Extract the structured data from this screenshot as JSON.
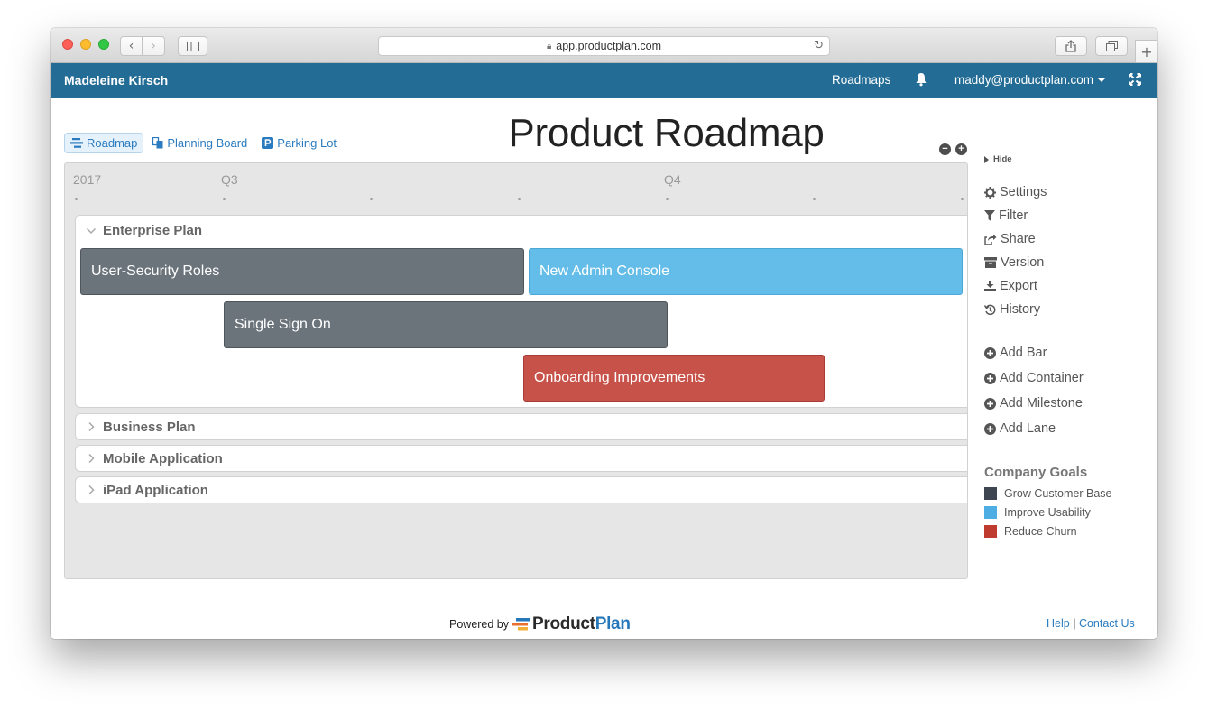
{
  "browser": {
    "url": "app.productplan.com"
  },
  "header": {
    "user_name": "Madeleine Kirsch",
    "nav_roadmaps": "Roadmaps",
    "account_email": "maddy@productplan.com"
  },
  "view_tabs": [
    {
      "label": "Roadmap",
      "active": true
    },
    {
      "label": "Planning Board",
      "active": false
    },
    {
      "label": "Parking Lot",
      "active": false
    }
  ],
  "page_title": "Product Roadmap",
  "zoom": {
    "out": "−",
    "in": "+"
  },
  "timeline": {
    "labels": [
      "2017",
      "Q3",
      "Q4"
    ]
  },
  "lanes": [
    {
      "title": "Enterprise Plan",
      "expanded": true,
      "bars": [
        {
          "label": "User-Security Roles",
          "goal": "Grow Customer Base"
        },
        {
          "label": "New Admin Console",
          "goal": "Improve Usability"
        },
        {
          "label": "Single Sign On",
          "goal": "Grow Customer Base"
        },
        {
          "label": "Onboarding Improvements",
          "goal": "Reduce Churn"
        }
      ]
    },
    {
      "title": "Business Plan",
      "expanded": false
    },
    {
      "title": "Mobile Application",
      "expanded": false
    },
    {
      "title": "iPad Application",
      "expanded": false
    }
  ],
  "side_panel": {
    "hide_label": "Hide",
    "actions": [
      "Settings",
      "Filter",
      "Share",
      "Version",
      "Export",
      "History"
    ],
    "add_actions": [
      "Add Bar",
      "Add Container",
      "Add Milestone",
      "Add Lane"
    ],
    "goals_title": "Company Goals",
    "goals": [
      {
        "label": "Grow Customer Base",
        "color": "#3d4651"
      },
      {
        "label": "Improve Usability",
        "color": "#4eaee3"
      },
      {
        "label": "Reduce Churn",
        "color": "#bf3b2f"
      }
    ]
  },
  "colors": {
    "header_bg": "#236c95",
    "link": "#2a7bbf",
    "bar_gray": "#6b737b",
    "bar_blue": "#63bde8",
    "bar_red": "#c7524a"
  },
  "footer": {
    "powered_by": "Powered by",
    "logo_product": "Product",
    "logo_plan": "Plan",
    "help": "Help",
    "separator": "|",
    "contact": "Contact Us"
  }
}
